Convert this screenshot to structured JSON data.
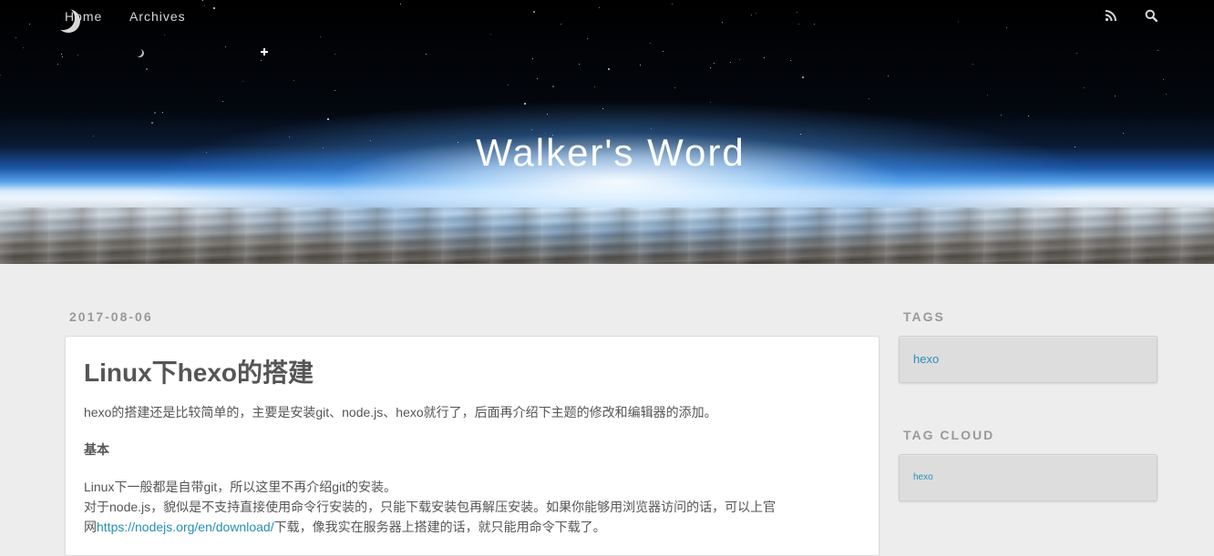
{
  "nav": {
    "home": "Home",
    "archives": "Archives",
    "rss_icon": "rss-icon",
    "search_icon": "search-icon"
  },
  "site": {
    "title": "Walker's Word"
  },
  "post": {
    "date": "2017-08-06",
    "title": "Linux下hexo的搭建",
    "intro": "hexo的搭建还是比较简单的，主要是安装git、node.js、hexo就行了，后面再介绍下主题的修改和编辑器的添加。",
    "heading": "基本",
    "line1": "Linux下一般都是自带git，所以这里不再介绍git的安装。",
    "line2": "对于node.js，貌似是不支持直接使用命令行安装的，只能下载安装包再解压安装。如果你能够用浏览器访问的话，可以上官",
    "line3_prefix": "网",
    "line3_link": "https://nodejs.org/en/download/",
    "line3_suffix": "下载，像我实在服务器上搭建的话，就只能用命令下载了。"
  },
  "sidebar": {
    "tags_title": "TAGS",
    "tags": [
      "hexo"
    ],
    "tag_cloud_title": "TAG CLOUD",
    "tag_cloud": [
      "hexo"
    ]
  },
  "colors": {
    "link": "#258fb8",
    "page_bg": "#ededed",
    "muted": "#999999"
  }
}
